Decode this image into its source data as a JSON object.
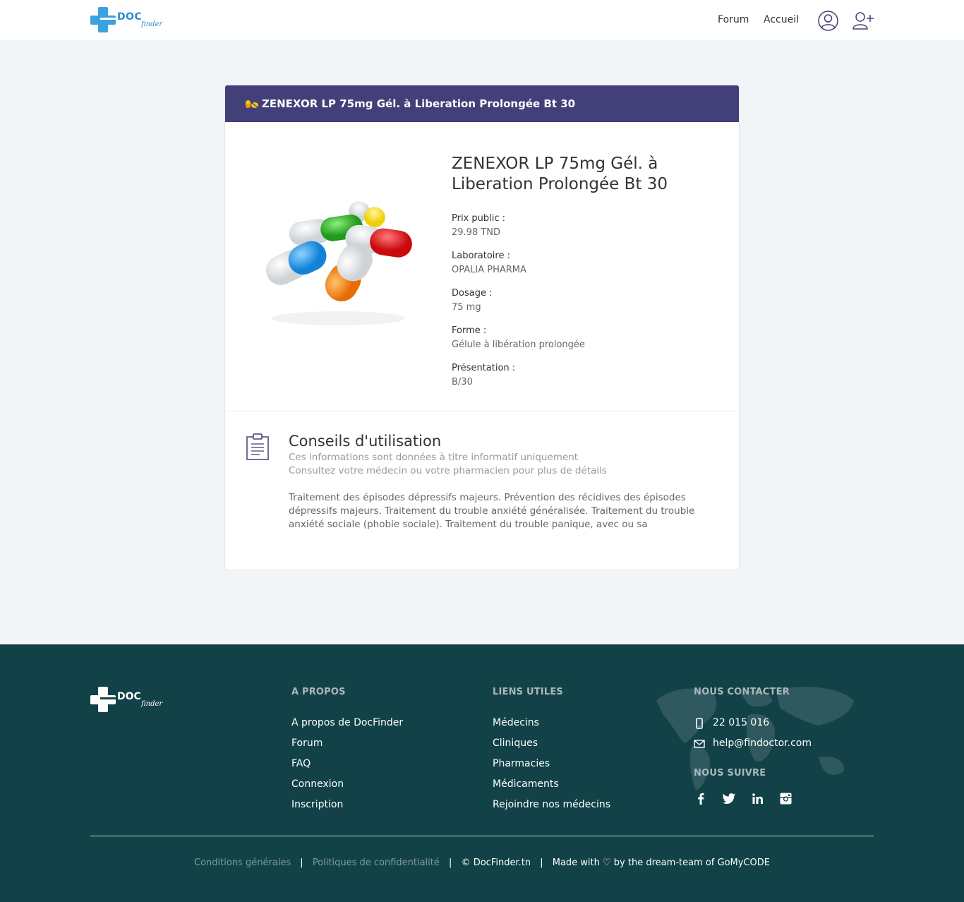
{
  "header": {
    "logo_doc": "DOC",
    "logo_finder": "finder",
    "nav_forum": "Forum",
    "nav_accueil": "Accueil",
    "icons": [
      "user-icon",
      "add-user-icon"
    ]
  },
  "card": {
    "header_title": "ZENEXOR LP 75mg Gél. à Liberation Prolongée Bt 30",
    "header_icon": "pills-icon",
    "title": "ZENEXOR LP 75mg Gél. à Liberation Prolongée Bt 30",
    "fields": [
      {
        "label": "Prix public :",
        "value": "29.98 TND"
      },
      {
        "label": "Laboratoire :",
        "value": "OPALIA PHARMA"
      },
      {
        "label": "Dosage :",
        "value": "75 mg"
      },
      {
        "label": "Forme :",
        "value": "Gélule à libération prolongée"
      },
      {
        "label": "Présentation :",
        "value": "B/30"
      }
    ]
  },
  "conseils": {
    "title": "Conseils d'utilisation",
    "subtitle_1": "Ces informations sont données à titre informatif uniquement",
    "subtitle_2": "Consultez votre médecin ou votre pharmacien pour plus de détails",
    "text": "Traitement des épisodes dépressifs majeurs. Prévention des récidives des épisodes dépressifs majeurs. Traitement du trouble anxiété généralisée. Traitement du trouble anxiété sociale (phobie sociale). Traitement du trouble panique, avec ou sa"
  },
  "footer": {
    "logo_doc": "DOC",
    "logo_finder": "finder",
    "apropos": {
      "title": "A PROPOS",
      "links": [
        "A propos de DocFinder",
        "Forum",
        "FAQ",
        "Connexion",
        "Inscription"
      ]
    },
    "liens": {
      "title": "LIENS UTILES",
      "links": [
        "Médecins",
        "Cliniques",
        "Pharmacies",
        "Médicaments",
        "Rejoindre nos médecins"
      ]
    },
    "contact": {
      "title": "NOUS CONTACTER",
      "phone": "22 015 016",
      "email": "help@findoctor.com",
      "follow_title": "NOUS SUIVRE",
      "socials": [
        "facebook-icon",
        "twitter-icon",
        "linkedin-icon",
        "instagram-icon"
      ]
    },
    "legal": {
      "conditions": "Conditions générales",
      "politiques": "Politiques de confidentialité",
      "copyright": "© DocFinder.tn",
      "made_with": "Made with ♡ by the dream-team of GoMyCODE"
    }
  }
}
